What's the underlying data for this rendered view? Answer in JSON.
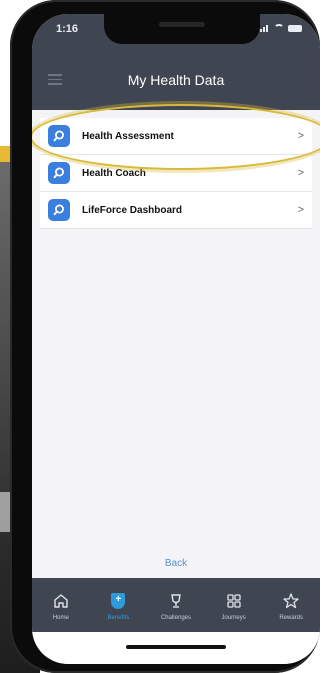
{
  "status_bar": {
    "time": "1:16"
  },
  "header": {
    "title": "My Health Data"
  },
  "list": {
    "items": [
      {
        "label": "Health Assessment",
        "chevron": ">"
      },
      {
        "label": "Health Coach",
        "chevron": ">"
      },
      {
        "label": "LifeForce Dashboard",
        "chevron": ">"
      }
    ]
  },
  "back_label": "Back",
  "tabbar": {
    "tabs": [
      {
        "label": "Home",
        "icon": "home-icon"
      },
      {
        "label": "Benefits",
        "icon": "shield-plus-icon",
        "active": true
      },
      {
        "label": "Challenges",
        "icon": "trophy-icon"
      },
      {
        "label": "Journeys",
        "icon": "grid-icon"
      },
      {
        "label": "Rewards",
        "icon": "star-icon"
      }
    ]
  },
  "colors": {
    "header_bg": "#3f4652",
    "accent_blue": "#3a7ede",
    "active_tab": "#2e9bdc",
    "highlight_ring": "#d9b93a",
    "back_link": "#5b8fd6"
  }
}
